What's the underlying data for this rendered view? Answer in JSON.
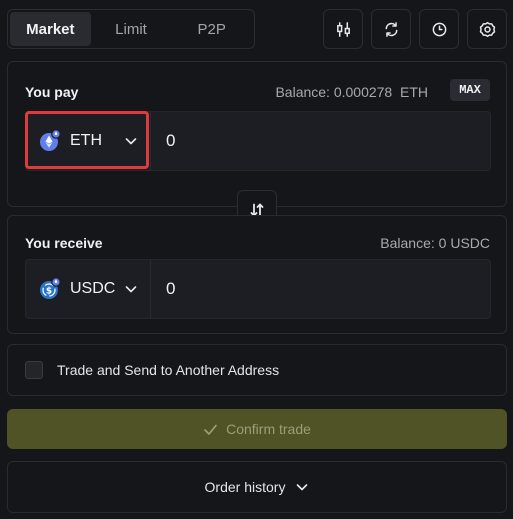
{
  "tabs": [
    {
      "label": "Market",
      "active": true
    },
    {
      "label": "Limit",
      "active": false
    },
    {
      "label": "P2P",
      "active": false
    }
  ],
  "toolbar": {
    "icons": [
      "chart-settings-icon",
      "refresh-icon",
      "history-clock-icon",
      "gear-icon"
    ]
  },
  "pay": {
    "label": "You pay",
    "balance_label": "Balance: 0.000278",
    "balance_unit": "ETH",
    "max_label": "MAX",
    "token_symbol": "ETH",
    "amount": "0"
  },
  "receive": {
    "label": "You receive",
    "balance_label": "Balance: 0 USDC",
    "token_symbol": "USDC",
    "amount": "0"
  },
  "options": {
    "send_to_other_label": "Trade and Send to Another Address",
    "checked": false
  },
  "confirm": {
    "label": "Confirm trade"
  },
  "history": {
    "label": "Order history"
  },
  "colors": {
    "accent_disabled": "#4f5325",
    "highlight": "#e03b3b",
    "eth": "#627eea",
    "usdc": "#2775ca"
  }
}
